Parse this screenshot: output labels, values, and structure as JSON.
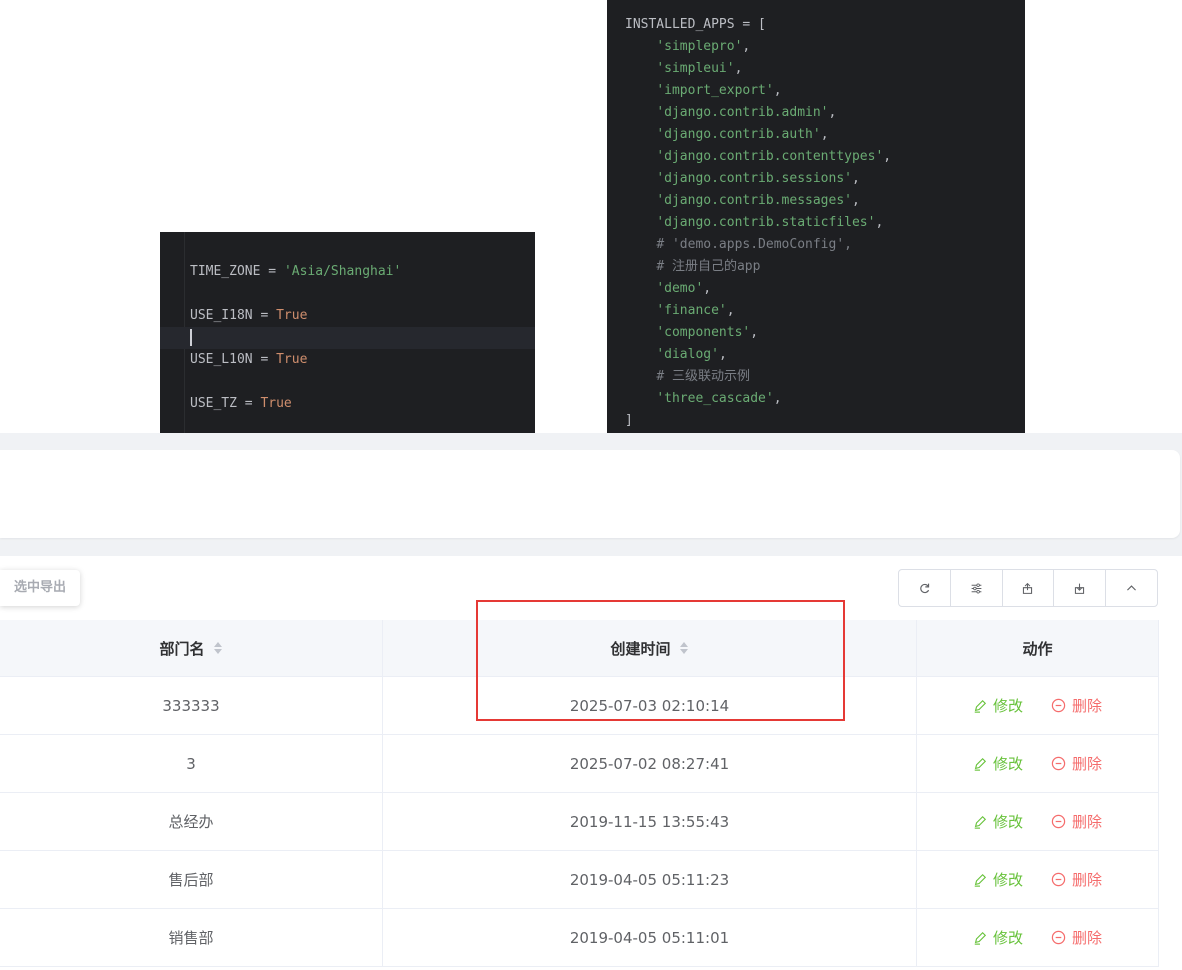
{
  "code_timezone": {
    "lines": [
      {
        "k": "TIME_ZONE",
        "op": " = ",
        "v": "'Asia/Shanghai'",
        "t": "str"
      },
      {
        "k": "",
        "op": "",
        "v": "",
        "t": "blank"
      },
      {
        "k": "USE_I18N",
        "op": " = ",
        "v": "True",
        "t": "kw"
      },
      {
        "k": "",
        "op": "",
        "v": "",
        "t": "caret"
      },
      {
        "k": "USE_L10N",
        "op": " = ",
        "v": "True",
        "t": "kw"
      },
      {
        "k": "",
        "op": "",
        "v": "",
        "t": "blank"
      },
      {
        "k": "USE_TZ",
        "op": " = ",
        "v": "True",
        "t": "kw"
      }
    ]
  },
  "code_apps": {
    "lines": [
      {
        "text": "INSTALLED_APPS = [",
        "t": "plain",
        "indent": ""
      },
      {
        "text": "'simplepro'",
        "t": "str",
        "indent": "    ",
        "tail": ","
      },
      {
        "text": "'simpleui'",
        "t": "str",
        "indent": "    ",
        "tail": ","
      },
      {
        "text": "'import_export'",
        "t": "str",
        "indent": "    ",
        "tail": ","
      },
      {
        "text": "'django.contrib.admin'",
        "t": "str",
        "indent": "    ",
        "tail": ","
      },
      {
        "text": "'django.contrib.auth'",
        "t": "str",
        "indent": "    ",
        "tail": ","
      },
      {
        "text": "'django.contrib.contenttypes'",
        "t": "str",
        "indent": "    ",
        "tail": ","
      },
      {
        "text": "'django.contrib.sessions'",
        "t": "str",
        "indent": "    ",
        "tail": ","
      },
      {
        "text": "'django.contrib.messages'",
        "t": "str",
        "indent": "    ",
        "tail": ","
      },
      {
        "text": "'django.contrib.staticfiles'",
        "t": "str",
        "indent": "    ",
        "tail": ","
      },
      {
        "text": "# 'demo.apps.DemoConfig',",
        "t": "cmt",
        "indent": "    ",
        "tail": ""
      },
      {
        "text": "# 注册自己的app",
        "t": "cmt",
        "indent": "    ",
        "tail": ""
      },
      {
        "text": "'demo'",
        "t": "str",
        "indent": "    ",
        "tail": ","
      },
      {
        "text": "'finance'",
        "t": "str",
        "indent": "    ",
        "tail": ","
      },
      {
        "text": "'components'",
        "t": "str",
        "indent": "    ",
        "tail": ","
      },
      {
        "text": "'dialog'",
        "t": "str",
        "indent": "    ",
        "tail": ","
      },
      {
        "text": "# 三级联动示例",
        "t": "cmt",
        "indent": "    ",
        "tail": ""
      },
      {
        "text": "'three_cascade'",
        "t": "str",
        "indent": "    ",
        "tail": ","
      },
      {
        "text": "]",
        "t": "plain",
        "indent": ""
      }
    ]
  },
  "toolbar": {
    "export_selected_label": "选中导出",
    "buttons": [
      "refresh-icon",
      "filter-columns-icon",
      "export-icon",
      "import-icon",
      "collapse-icon"
    ]
  },
  "table": {
    "headers": {
      "department": "部门名",
      "created_time": "创建时间",
      "actions": "动作"
    },
    "edit_label": "修改",
    "delete_label": "删除",
    "rows": [
      {
        "department": "333333",
        "created_time": "2025-07-03 02:10:14"
      },
      {
        "department": "3",
        "created_time": "2025-07-02 08:27:41"
      },
      {
        "department": "总经办",
        "created_time": "2019-11-15 13:55:43"
      },
      {
        "department": "售后部",
        "created_time": "2019-04-05 05:11:23"
      },
      {
        "department": "销售部",
        "created_time": "2019-04-05 05:11:01"
      }
    ]
  },
  "colors": {
    "edit": "#67c23a",
    "delete": "#f56c6c",
    "highlight": "#e53935"
  }
}
